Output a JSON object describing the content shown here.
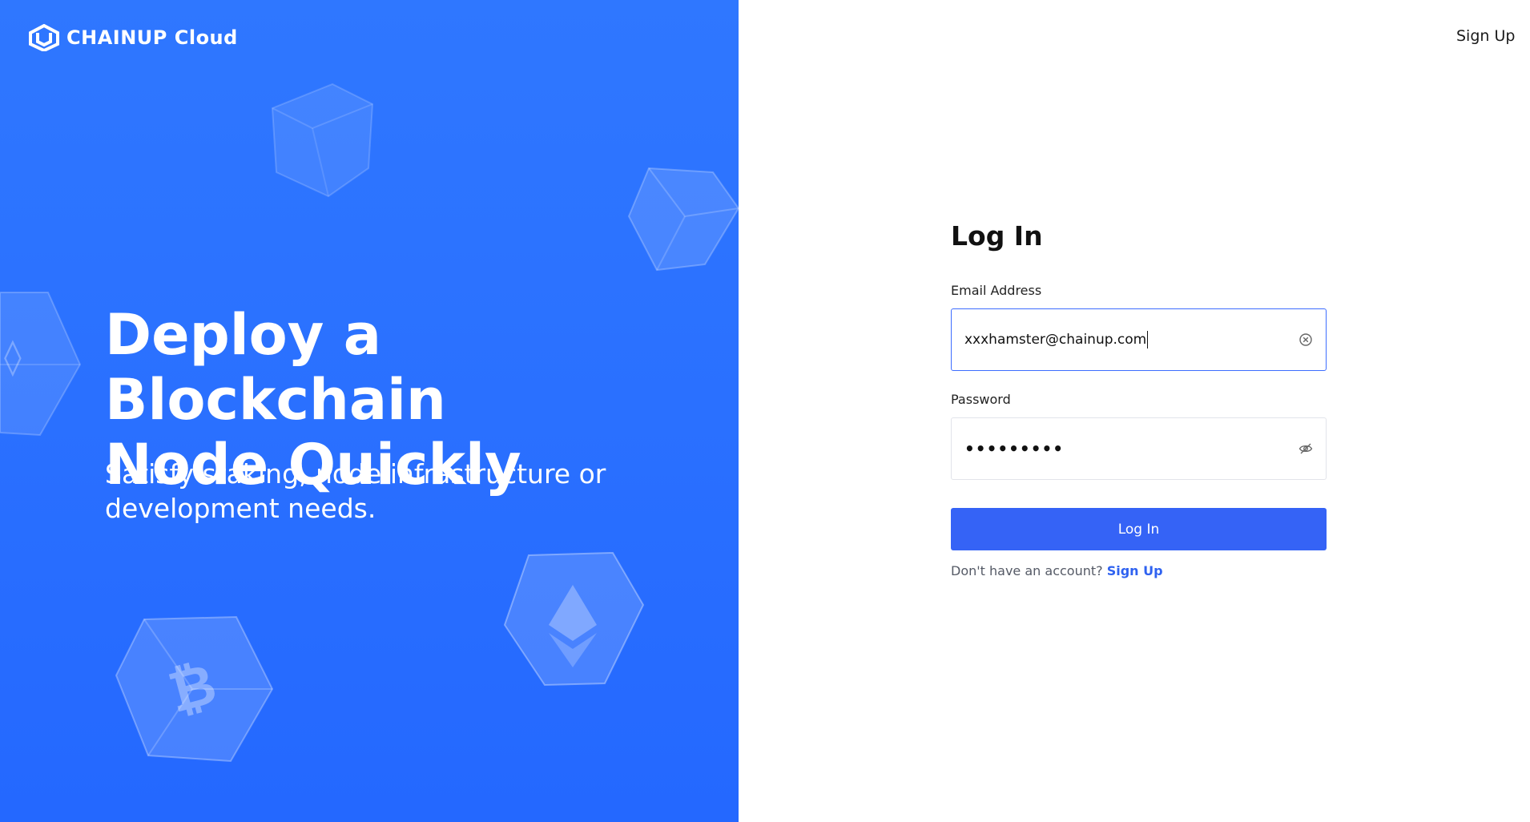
{
  "brand": {
    "logo_text": "CHAINUP Cloud",
    "color_primary": "#2f77ff",
    "color_button": "#3563f6"
  },
  "nav": {
    "signup_label": "Sign Up"
  },
  "hero": {
    "headline_line1": "Deploy a Blockchain",
    "headline_line2": "Node Quickly",
    "subline_line1": "Satisfy staking, node infrastructure or",
    "subline_line2": "development needs."
  },
  "form": {
    "title": "Log In",
    "email_label": "Email Address",
    "email_value": "xxxhamster@chainup.com",
    "password_label": "Password",
    "password_value": "•••••••••",
    "submit_label": "Log In",
    "no_account_text": "Don't have an account?",
    "signup_link": "Sign Up"
  },
  "icons": {
    "clear": "clear-circle-icon",
    "visibility": "eye-hidden-icon"
  }
}
